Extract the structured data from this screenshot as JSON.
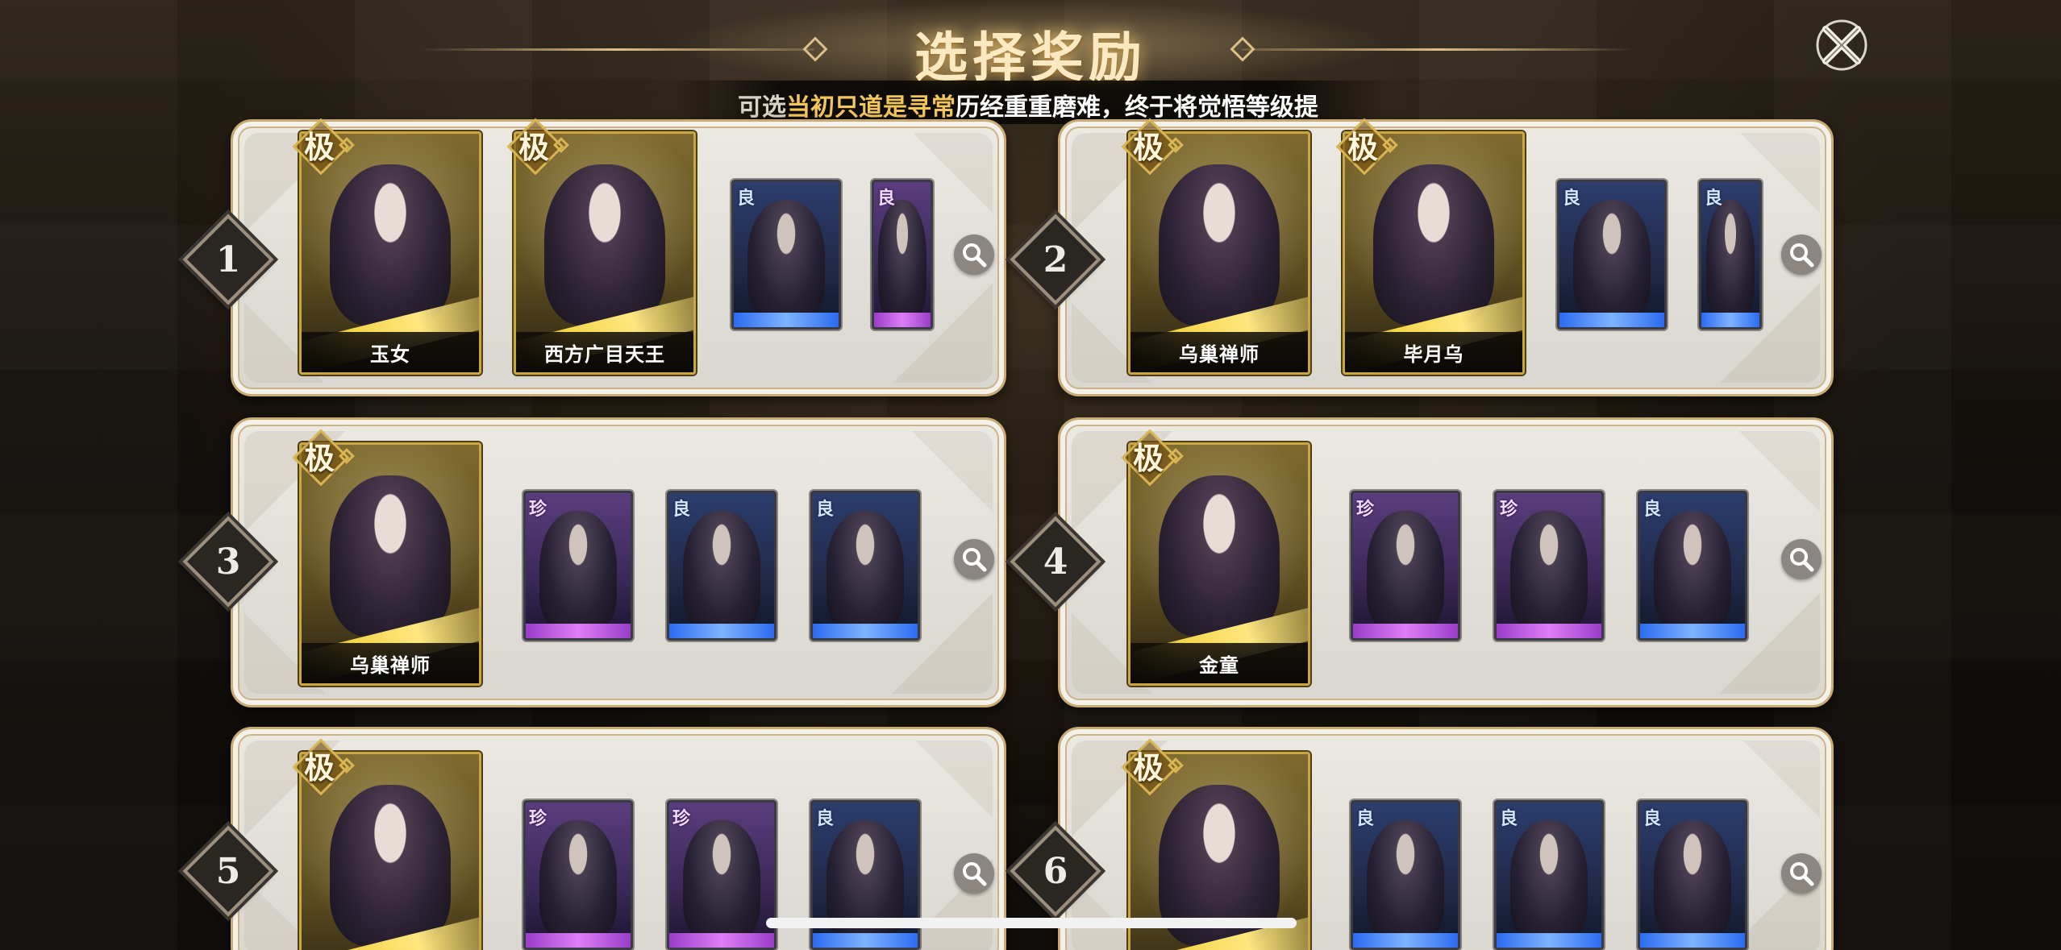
{
  "header": {
    "title": "选择奖励",
    "subtitle_prefix": "可选",
    "subtitle_highlight": "当初只道是寻常",
    "subtitle_body": "历经重重磨难，终于将觉悟等级提"
  },
  "close_icon": "close-x-icon",
  "search_icon": "magnifier-icon",
  "rarity_labels": {
    "top": "极",
    "rare": "珍",
    "good": "良"
  },
  "colors": {
    "gold": "#c9a640",
    "title_glow": "#fbe9c1",
    "highlight": "#f3c65a",
    "good_frame": "#2b6cf0",
    "rare_frame": "#9a3ec8"
  },
  "options": [
    {
      "number": "1",
      "featured": [
        {
          "rarity": "极",
          "name": "玉女"
        },
        {
          "rarity": "极",
          "name": "西方广目天王"
        }
      ],
      "extras": [
        {
          "rarity": "良"
        },
        {
          "rarity": "良"
        }
      ]
    },
    {
      "number": "2",
      "featured": [
        {
          "rarity": "极",
          "name": "乌巢禅师"
        },
        {
          "rarity": "极",
          "name": "毕月乌"
        }
      ],
      "extras": [
        {
          "rarity": "良"
        },
        {
          "rarity": "良"
        }
      ]
    },
    {
      "number": "3",
      "featured": [
        {
          "rarity": "极",
          "name": "乌巢禅师"
        }
      ],
      "extras": [
        {
          "rarity": "珍"
        },
        {
          "rarity": "良"
        },
        {
          "rarity": "良"
        }
      ]
    },
    {
      "number": "4",
      "featured": [
        {
          "rarity": "极",
          "name": "金童"
        }
      ],
      "extras": [
        {
          "rarity": "珍"
        },
        {
          "rarity": "珍"
        },
        {
          "rarity": "良"
        }
      ]
    },
    {
      "number": "5",
      "featured": [
        {
          "rarity": "极",
          "name": ""
        }
      ],
      "extras": [
        {
          "rarity": "珍"
        },
        {
          "rarity": "珍"
        },
        {
          "rarity": "良"
        }
      ]
    },
    {
      "number": "6",
      "featured": [
        {
          "rarity": "极",
          "name": ""
        }
      ],
      "extras": [
        {
          "rarity": "良"
        },
        {
          "rarity": "良"
        },
        {
          "rarity": "良"
        }
      ]
    }
  ]
}
